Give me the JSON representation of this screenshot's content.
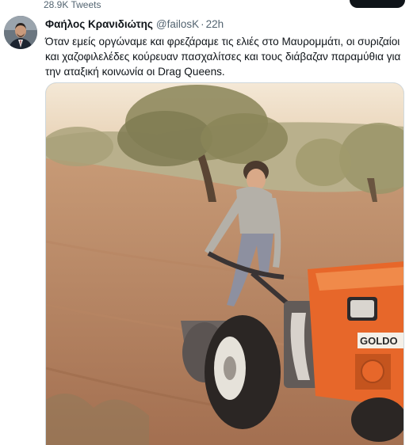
{
  "profile_header": {
    "tweets_count": "28.9K Tweets"
  },
  "tweet": {
    "author": {
      "display_name": "Φαήλος Κρανιδιώτης",
      "handle": "@failosK"
    },
    "separator": "·",
    "timestamp": "22h",
    "text_line1": "Όταν εμείς οργώναμε και φρεζάραμε τις ελιές στο Μαυρομμάτι, οι συριζαίοι",
    "text_line2": "και χαζοφιλελέδες κούρευαν πασχαλίτσες και τους διάβαζαν παραμύθια για",
    "text_line3": "την αταξική κοινωνία οι Drag Queens.",
    "photo": {
      "tractor_brand": "GOLDO"
    }
  },
  "colors": {
    "text_primary": "#0f1419",
    "text_secondary": "#536471",
    "border": "#cfd9de",
    "tractor_orange": "#e7672a"
  },
  "icons": [
    "avatar-image"
  ]
}
